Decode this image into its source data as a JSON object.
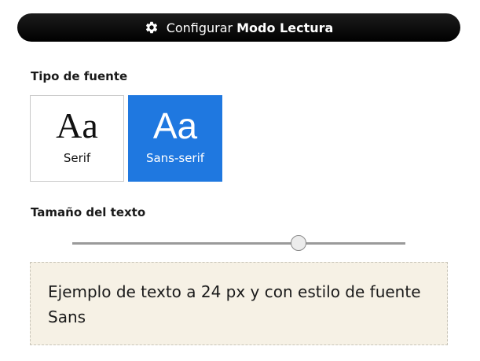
{
  "header": {
    "prefix": "Configurar",
    "title": "Modo Lectura",
    "icon": "gear-icon"
  },
  "font_section": {
    "label": "Tipo de fuente",
    "options": [
      {
        "sample": "Aa",
        "label": "Serif",
        "selected": false
      },
      {
        "sample": "Aa",
        "label": "Sans-serif",
        "selected": true
      }
    ],
    "selected_color": "#1f78e0"
  },
  "size_section": {
    "label": "Tamaño del texto",
    "slider_level": 0.68
  },
  "preview": {
    "text": "Ejemplo de texto a 24 px y con estilo de fuente Sans",
    "background": "#f6f1e5"
  }
}
